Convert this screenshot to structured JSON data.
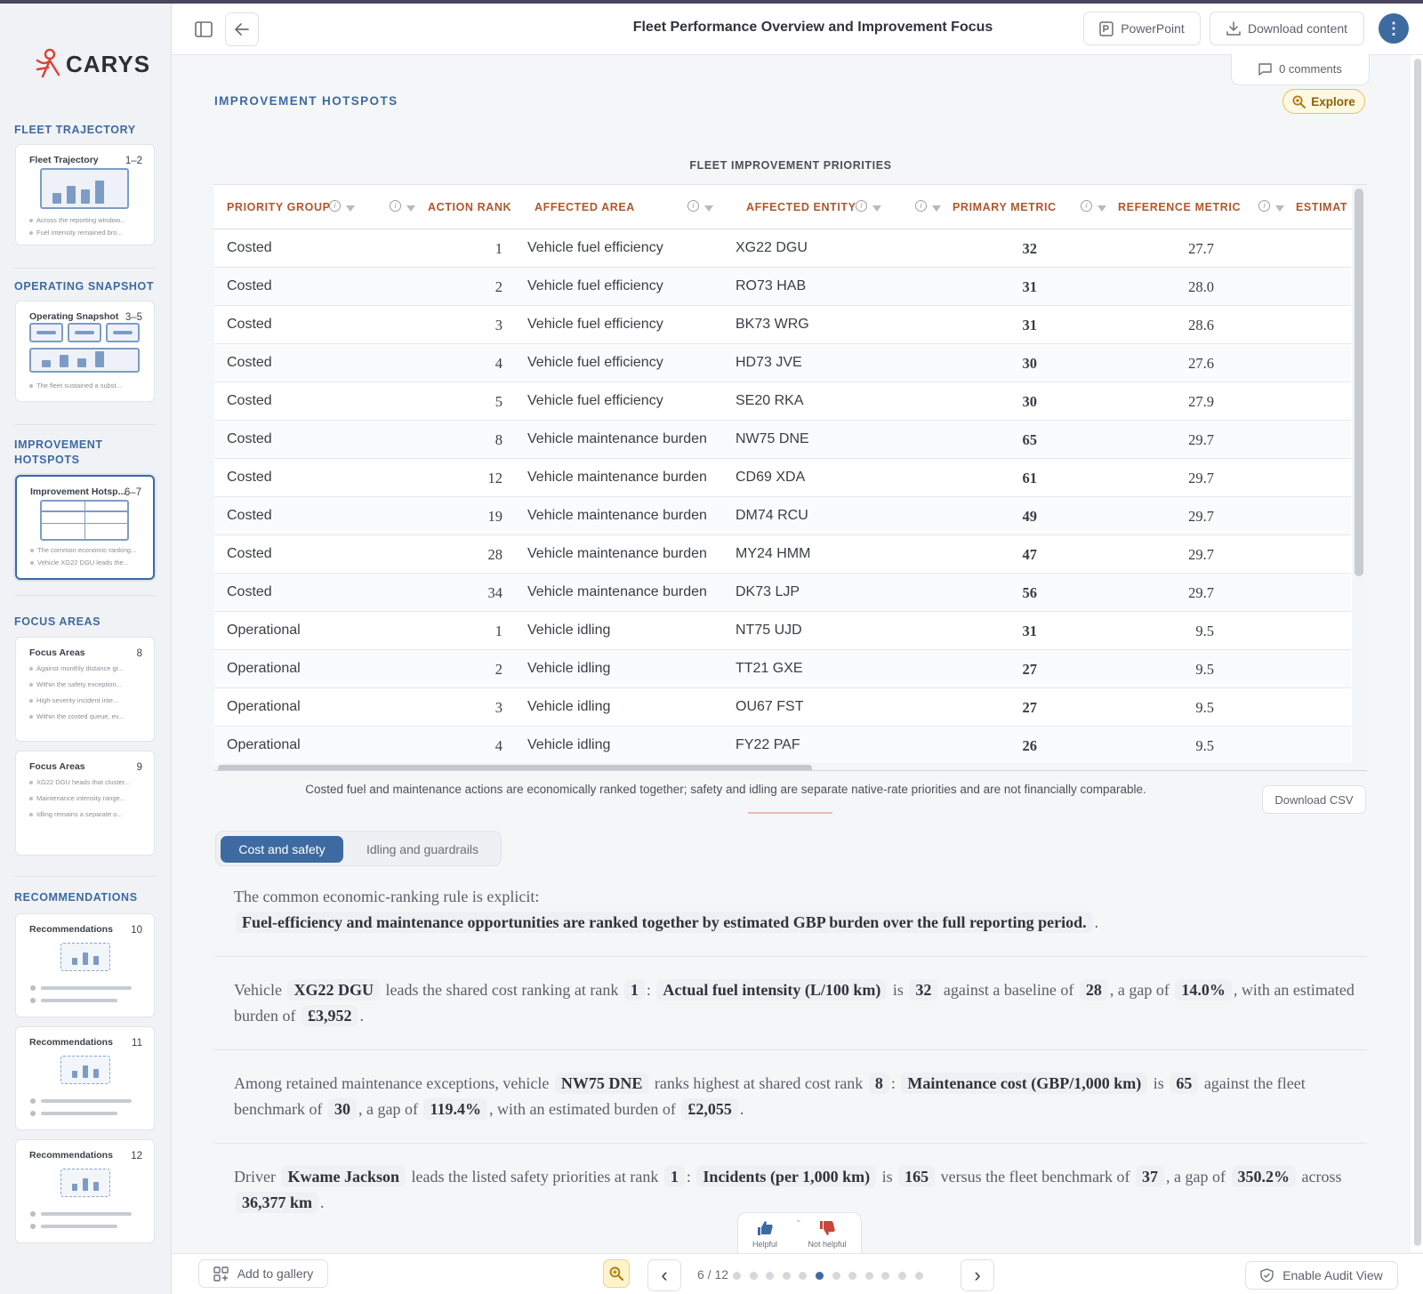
{
  "brand": {
    "logo_text": "CARYS",
    "accent": "#3d6aa0",
    "heading_color": "#b0572d"
  },
  "header": {
    "title": "Fleet Performance Overview and Improvement Focus",
    "powerpoint": "PowerPoint",
    "download": "Download content",
    "comments": "0 comments",
    "avatar_icon": "kebab-menu-icon"
  },
  "sidebar": {
    "sections": [
      {
        "heading": "FLEET TRAJECTORY",
        "thumbs": [
          {
            "title": "Fleet Trajectory",
            "range": "1–2",
            "bullets": [
              "Across the reporting window...",
              "Fuel intensity remained bro..."
            ]
          }
        ]
      },
      {
        "heading": "OPERATING SNAPSHOT",
        "thumbs": [
          {
            "title": "Operating Snapshot",
            "range": "3–5",
            "bullets": [
              "The fleet sustained a subst..."
            ]
          }
        ]
      },
      {
        "heading": "IMPROVEMENT HOTSPOTS",
        "thumbs": [
          {
            "title": "Improvement Hotsp...",
            "range": "6–7",
            "bullets": [
              "The common economic-ranking...",
              "Vehicle XG22 DGU leads the..."
            ]
          }
        ]
      },
      {
        "heading": "FOCUS AREAS",
        "thumbs": [
          {
            "title": "Focus Areas",
            "range": "8",
            "bullets": [
              "Against monthly distance gr...",
              "Within the safety exception...",
              "High-severity incident inte...",
              "Within the costed queue, ev..."
            ]
          },
          {
            "title": "Focus Areas",
            "range": "9",
            "bullets": [
              "XG22 DGU heads that cluster...",
              "Maintenance intensity range...",
              "Idling remains a separate o..."
            ]
          }
        ]
      },
      {
        "heading": "RECOMMENDATIONS",
        "thumbs": [
          {
            "title": "Recommendations",
            "range": "10"
          },
          {
            "title": "Recommendations",
            "range": "11"
          },
          {
            "title": "Recommendations",
            "range": "12"
          }
        ]
      }
    ]
  },
  "main": {
    "section_label": "IMPROVEMENT HOTSPOTS",
    "explore": "Explore",
    "table_title": "FLEET IMPROVEMENT PRIORITIES",
    "columns": [
      "PRIORITY GROUP",
      "ACTION RANK",
      "AFFECTED AREA",
      "AFFECTED ENTITY",
      "PRIMARY METRIC",
      "REFERENCE METRIC",
      "ESTIMAT"
    ],
    "rows": [
      [
        "Costed",
        "1",
        "Vehicle fuel efficiency",
        "XG22 DGU",
        "32",
        "27.7"
      ],
      [
        "Costed",
        "2",
        "Vehicle fuel efficiency",
        "RO73 HAB",
        "31",
        "28.0"
      ],
      [
        "Costed",
        "3",
        "Vehicle fuel efficiency",
        "BK73 WRG",
        "31",
        "28.6"
      ],
      [
        "Costed",
        "4",
        "Vehicle fuel efficiency",
        "HD73 JVE",
        "30",
        "27.6"
      ],
      [
        "Costed",
        "5",
        "Vehicle fuel efficiency",
        "SE20 RKA",
        "30",
        "27.9"
      ],
      [
        "Costed",
        "8",
        "Vehicle maintenance burden",
        "NW75 DNE",
        "65",
        "29.7"
      ],
      [
        "Costed",
        "12",
        "Vehicle maintenance burden",
        "CD69 XDA",
        "61",
        "29.7"
      ],
      [
        "Costed",
        "19",
        "Vehicle maintenance burden",
        "DM74 RCU",
        "49",
        "29.7"
      ],
      [
        "Costed",
        "28",
        "Vehicle maintenance burden",
        "MY24 HMM",
        "47",
        "29.7"
      ],
      [
        "Costed",
        "34",
        "Vehicle maintenance burden",
        "DK73 LJP",
        "56",
        "29.7"
      ],
      [
        "Operational",
        "1",
        "Vehicle idling",
        "NT75 UJD",
        "31",
        "9.5"
      ],
      [
        "Operational",
        "2",
        "Vehicle idling",
        "TT21 GXE",
        "27",
        "9.5"
      ],
      [
        "Operational",
        "3",
        "Vehicle idling",
        "OU67 FST",
        "27",
        "9.5"
      ],
      [
        "Operational",
        "4",
        "Vehicle idling",
        "FY22 PAF",
        "26",
        "9.5"
      ]
    ],
    "footnote": "Costed fuel and maintenance actions are economically ranked together; safety and idling are separate native-rate priorities and are not financially comparable.",
    "download_csv": "Download CSV",
    "tabs": [
      "Cost and safety",
      "Idling and guardrails"
    ],
    "paragraphs": [
      {
        "t1": "The common economic-ranking rule is explicit:",
        "c1": "Fuel-efficiency and maintenance opportunities are ranked together by estimated GBP burden over the full reporting period.",
        "t2": "."
      },
      {
        "t1": "Vehicle",
        "c1": "XG22 DGU",
        "t2": "leads the shared cost ranking at rank",
        "c2": "1",
        "t3": ":",
        "c3": "Actual fuel intensity (L/100 km)",
        "t4": "is",
        "c4": "32",
        "t5": "against a baseline of",
        "c5": "28",
        "t6": ", a gap of",
        "c6": "14.0%",
        "t7": ", with an estimated burden of",
        "c7": "£3,952",
        "t8": "."
      },
      {
        "t1": "Among retained maintenance exceptions, vehicle",
        "c1": "NW75 DNE",
        "t2": "ranks highest at shared cost rank",
        "c2": "8",
        "t3": ":",
        "c3": "Maintenance cost (GBP/1,000 km)",
        "t4": "is",
        "c4": "65",
        "t5": "against the fleet benchmark of",
        "c5": "30",
        "t6": ", a gap of",
        "c6": "119.4%",
        "t7": ", with an estimated burden of",
        "c7": "£2,055",
        "t8": "."
      },
      {
        "t1": "Driver",
        "c1": "Kwame Jackson",
        "t2": "leads the listed safety priorities at rank",
        "c2": "1",
        "t3": ":",
        "c3": "Incidents (per 1,000 km)",
        "t4": "is",
        "c4": "165",
        "t5": "versus the fleet benchmark of",
        "c5": "37",
        "t6": ", a gap of",
        "c6": "350.2%",
        "t7": "across",
        "c7": "36,377 km",
        "t8": "."
      }
    ],
    "feedback": {
      "helpful": "Helpful",
      "not_helpful": "Not helpful"
    }
  },
  "footer": {
    "add_gallery": "Add to gallery",
    "page": "6 / 12",
    "page_current": 6,
    "page_total": 12,
    "audit": "Enable Audit View"
  }
}
